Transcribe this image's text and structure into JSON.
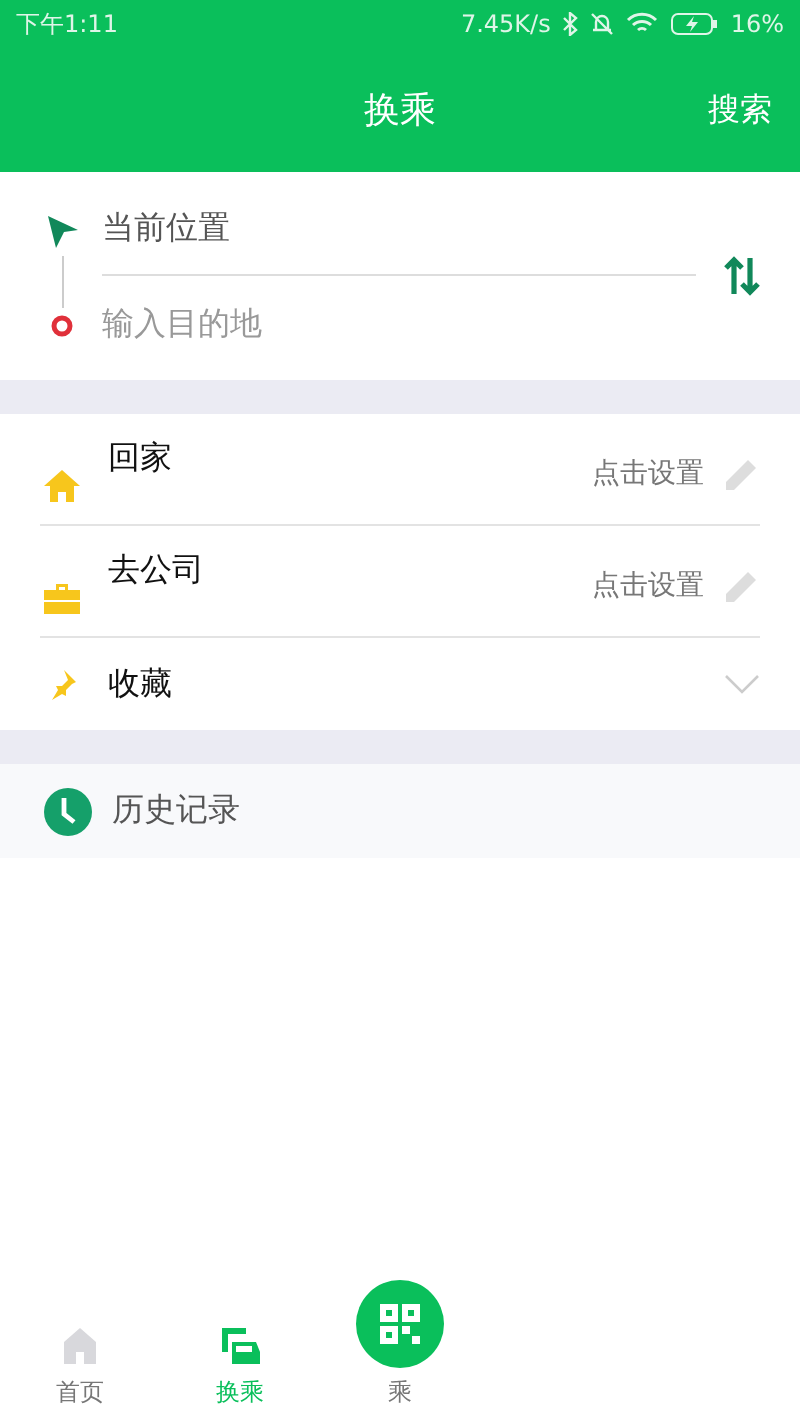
{
  "status_bar": {
    "time": "下午1:11",
    "speed": "7.45K/s",
    "battery": "16%"
  },
  "header": {
    "title": "换乘",
    "action": "搜索"
  },
  "route": {
    "origin": "当前位置",
    "destination_placeholder": "输入目的地"
  },
  "places": [
    {
      "kind": "home",
      "label": "回家",
      "hint": "点击设置"
    },
    {
      "kind": "work",
      "label": "去公司",
      "hint": "点击设置"
    },
    {
      "kind": "favorites",
      "label": "收藏",
      "expanded": false
    }
  ],
  "history": {
    "label": "历史记录"
  },
  "tabs": [
    {
      "kind": "home",
      "label": "首页",
      "selected": false
    },
    {
      "kind": "transfer",
      "label": "换乘",
      "selected": true
    },
    {
      "kind": "code",
      "label": "乘",
      "selected": false
    }
  ]
}
